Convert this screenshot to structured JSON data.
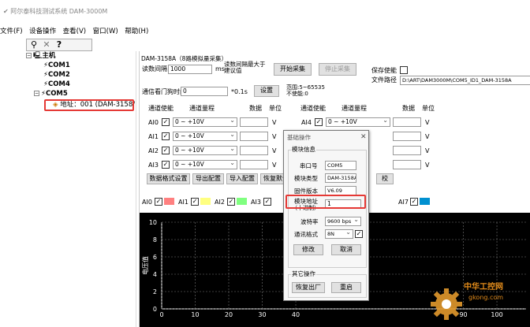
{
  "window_title": "阿尔泰科技测试系统 DAM-3000M",
  "menu": [
    "文件(F)",
    "设备操作",
    "查看(V)",
    "窗口(W)",
    "帮助(H)"
  ],
  "toolbar_icons": [
    "search-icon",
    "close-icon",
    "help-icon"
  ],
  "tree": {
    "root": "主机",
    "ports": [
      "COM1",
      "COM2",
      "COM4",
      "COM5"
    ],
    "device": "地址：001 (DAM-3158/"
  },
  "panel": {
    "device_title": "DAM-3158A（8路模拟量采集）",
    "read_interval_label": "读数间隔",
    "read_interval_value": "1000",
    "read_interval_unit": "ms",
    "read_interval_hint": "读数间隔最大于建议值",
    "start_button": "开始采集",
    "stop_button": "停止采集",
    "save_enable_label": "保存使能",
    "file_path_label": "文件路径",
    "file_path_value": "D:\\ART\\DAM3000M\\COM5_ID1_DAM-3158A",
    "watchdog_label": "通信看门狗时间",
    "watchdog_value": "0",
    "watchdog_unit": "*0.1s",
    "set_button": "设置",
    "range_note_1": "范围:5~65535",
    "range_note_2": "不使能:0",
    "col_enable": "通道使能",
    "col_range": "通道量程",
    "col_data": "数据",
    "col_unit": "单位",
    "left_channels": [
      {
        "name": "AI0",
        "range": "0 ~ +10V",
        "unit": "V"
      },
      {
        "name": "AI1",
        "range": "0 ~ +10V",
        "unit": "V"
      },
      {
        "name": "AI2",
        "range": "0 ~ +10V",
        "unit": "V"
      },
      {
        "name": "AI3",
        "range": "0 ~ +10V",
        "unit": "V"
      }
    ],
    "right_channels": [
      {
        "name": "AI4",
        "range": "0 ~ +10V",
        "unit": "V"
      },
      {
        "unit": "V"
      },
      {
        "unit": "V"
      },
      {
        "unit": "V"
      }
    ],
    "bottom_buttons": [
      "数据格式设置",
      "导出配置",
      "导入配置",
      "恢复默认"
    ],
    "bottom_button_right": "校",
    "legend": [
      {
        "name": "AI0",
        "color": "#ff8080"
      },
      {
        "name": "AI1",
        "color": "#ffff80"
      },
      {
        "name": "AI2",
        "color": "#80ff80"
      },
      {
        "name": "AI3",
        "color": "#80ffff"
      },
      {
        "name": "AI7",
        "color": "#0090d0"
      }
    ]
  },
  "chart_data": {
    "type": "line",
    "ylabel": "电压值",
    "y_ticks": [
      "10",
      "8",
      "6",
      "4",
      "2",
      "0"
    ],
    "x_ticks": [
      "0",
      "10",
      "20",
      "30",
      "40",
      "90",
      "100"
    ],
    "ylim": [
      0,
      10
    ],
    "series": [],
    "grid": true
  },
  "dialog": {
    "title": "基础操作",
    "module_info": "模块信息",
    "port_label": "串口号",
    "port_value": "COM5",
    "type_label": "模块类型",
    "type_value": "DAM-3158A",
    "fw_label": "固件版本",
    "fw_value": "V6.09",
    "addr_label_1": "模块地址",
    "addr_label_2": "（十进制）",
    "addr_value": "1",
    "baud_label": "波特率",
    "baud_value": "9600 bps",
    "format_label": "通讯格式",
    "format_value": "8N",
    "modify_button": "修改",
    "cancel_button": "取消",
    "other_ops": "其它操作",
    "factory_button": "恢复出厂",
    "restart_button": "重启"
  },
  "watermark": {
    "line1": "中华工控网",
    "line2": "gkong.com"
  }
}
